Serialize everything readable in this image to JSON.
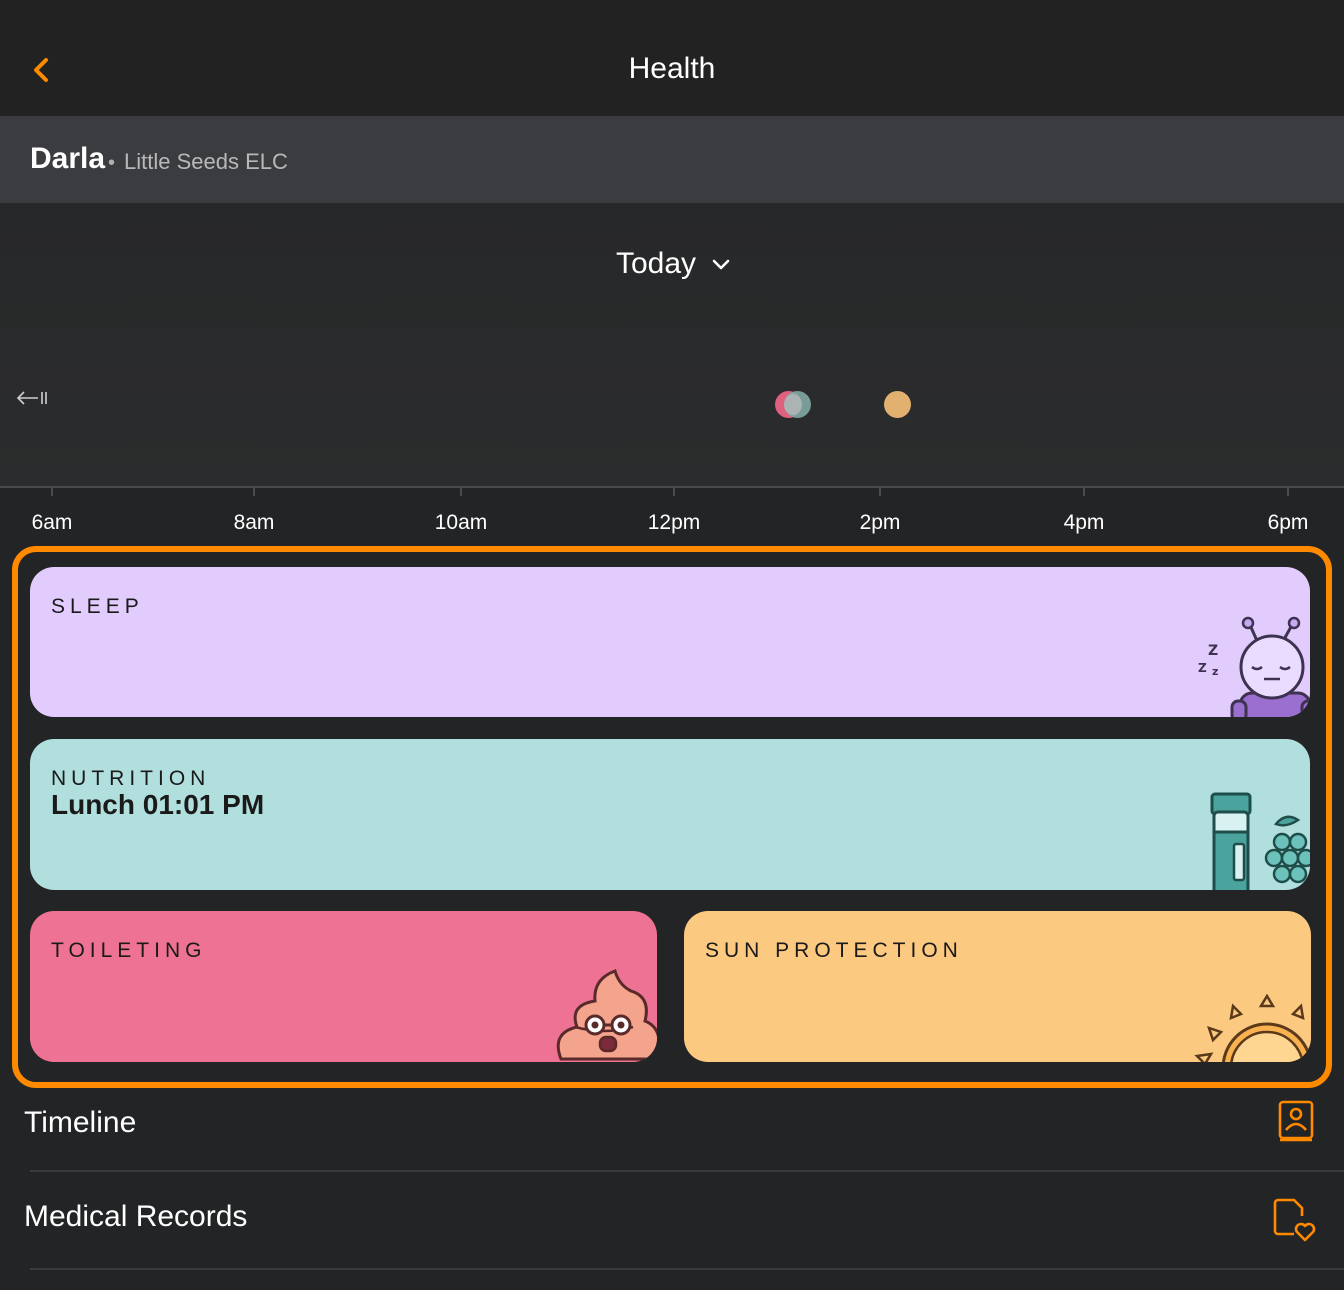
{
  "nav": {
    "title": "Health"
  },
  "child": {
    "name": "Darla",
    "separator": "•",
    "centre": "Little Seeds ELC"
  },
  "date_selector": {
    "label": "Today"
  },
  "timeline_axis": {
    "labels": [
      "6am",
      "8am",
      "10am",
      "12pm",
      "2pm",
      "4pm",
      "6pm"
    ]
  },
  "cards": {
    "sleep": {
      "title": "SLEEP",
      "color": "#e2ccfd"
    },
    "nutrition": {
      "title": "NUTRITION",
      "subtitle": "Lunch 01:01 PM",
      "color": "#b0dfdd"
    },
    "toileting": {
      "title": "TOILETING",
      "color": "#ee7293"
    },
    "sun_protection": {
      "title": "SUN PROTECTION",
      "color": "#fcc981"
    }
  },
  "rows": {
    "timeline": {
      "label": "Timeline",
      "icon": "contact-book-icon"
    },
    "medical": {
      "label": "Medical Records",
      "icon": "document-heart-icon"
    }
  },
  "colors": {
    "accent": "#ff8a00",
    "toileting_dot": "#e0607f",
    "nutrition_dot": "#7fa7a2",
    "sun_dot": "#e2b16f"
  }
}
